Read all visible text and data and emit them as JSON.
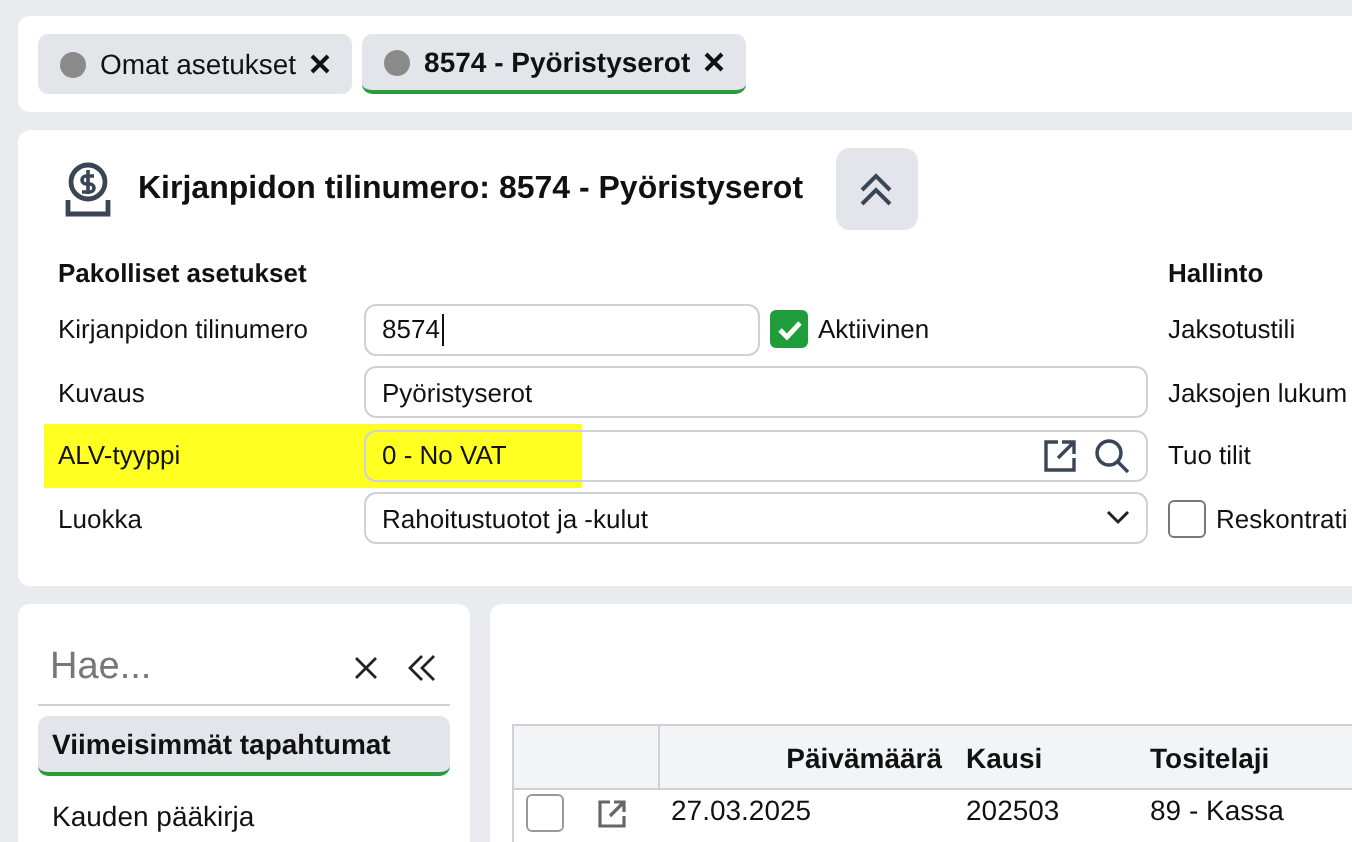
{
  "tabs": [
    {
      "label": "Omat asetukset",
      "selected": false
    },
    {
      "label": "8574 - Pyöristyserot",
      "selected": true
    }
  ],
  "header": {
    "title": "Kirjanpidon tilinumero: 8574 - Pyöristyserot"
  },
  "mandatory": {
    "heading": "Pakolliset asetukset",
    "active": {
      "label": "Aktiivinen",
      "checked": true
    },
    "rows": [
      {
        "label": "Kirjanpidon tilinumero",
        "value": "8574",
        "kind": "number",
        "highlighted": false
      },
      {
        "label": "Kuvaus",
        "value": "Pyöristyserot",
        "kind": "text",
        "highlighted": false
      },
      {
        "label": "ALV-tyyppi",
        "value": "0 - No VAT",
        "kind": "lookup",
        "highlighted": true
      },
      {
        "label": "Luokka",
        "value": "Rahoitustuotot ja -kulut",
        "kind": "select",
        "highlighted": false
      }
    ]
  },
  "admin": {
    "heading": "Hallinto",
    "rows": [
      {
        "label": "Jaksotustili",
        "kind": "field"
      },
      {
        "label": "Jaksojen lukum",
        "kind": "text"
      },
      {
        "label": "Tuo tilit",
        "kind": "text"
      },
      {
        "label": "Reskontrati",
        "kind": "checkbox",
        "checked": false
      }
    ]
  },
  "sidebar": {
    "search_placeholder": "Hae...",
    "items": [
      {
        "label": "Viimeisimmät tapahtumat",
        "selected": true
      },
      {
        "label": "Kauden pääkirja",
        "selected": false
      }
    ]
  },
  "table": {
    "columns": [
      "Päivämäärä",
      "Kausi",
      "Tositelaji"
    ],
    "rows": [
      {
        "checked": false,
        "cells": [
          "27.03.2025",
          "202503",
          "89 - Kassa"
        ]
      }
    ]
  }
}
